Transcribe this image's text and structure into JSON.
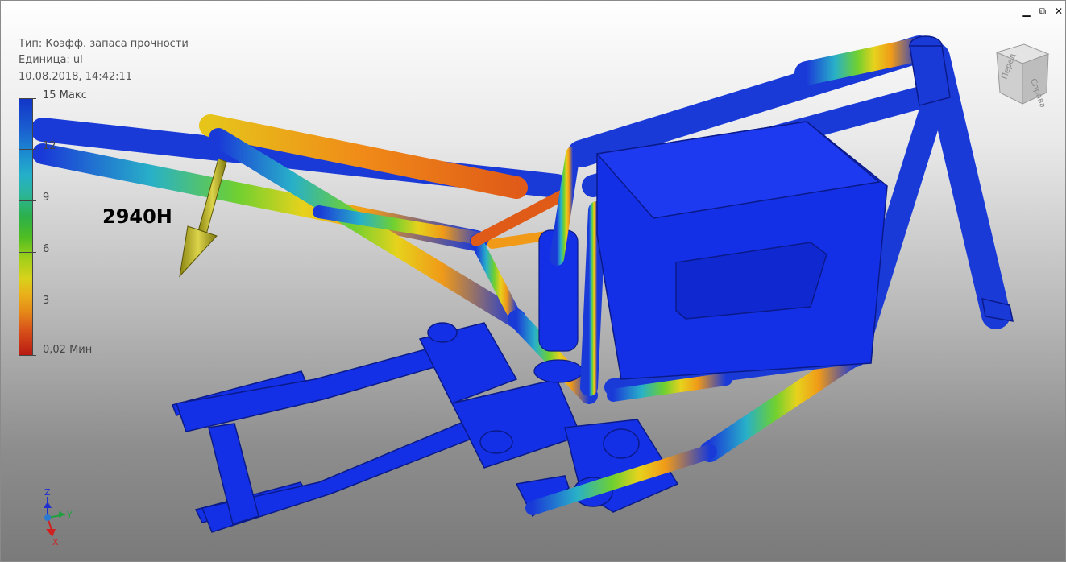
{
  "window": {
    "controls": {
      "minimize_icon": "minimize-icon",
      "restore_icon": "restore-icon",
      "close_icon": "close-icon",
      "minimize_glyph": "▁",
      "restore_glyph": "⧉",
      "close_glyph": "✕"
    }
  },
  "info": {
    "type_line": "Тип: Коэфф. запаса прочности",
    "unit_line": "Единица: ul",
    "datetime": "10.08.2018, 14:42:11"
  },
  "legend": {
    "max_label": "15 Макс",
    "ticks": [
      "12",
      "9",
      "6",
      "3"
    ],
    "min_label": "0,02 Мин",
    "colors": {
      "high": "#1235c8",
      "mid": "#2cb04a",
      "low_mid": "#d8d21b",
      "low": "#b81a12"
    }
  },
  "load": {
    "label": "2940Н",
    "arrow_color": "#b8b21a"
  },
  "viewcube": {
    "face_top": "Перед",
    "face_right": "Справа"
  },
  "axis_triad": {
    "z": "Z",
    "y": "Y",
    "x": "X"
  }
}
